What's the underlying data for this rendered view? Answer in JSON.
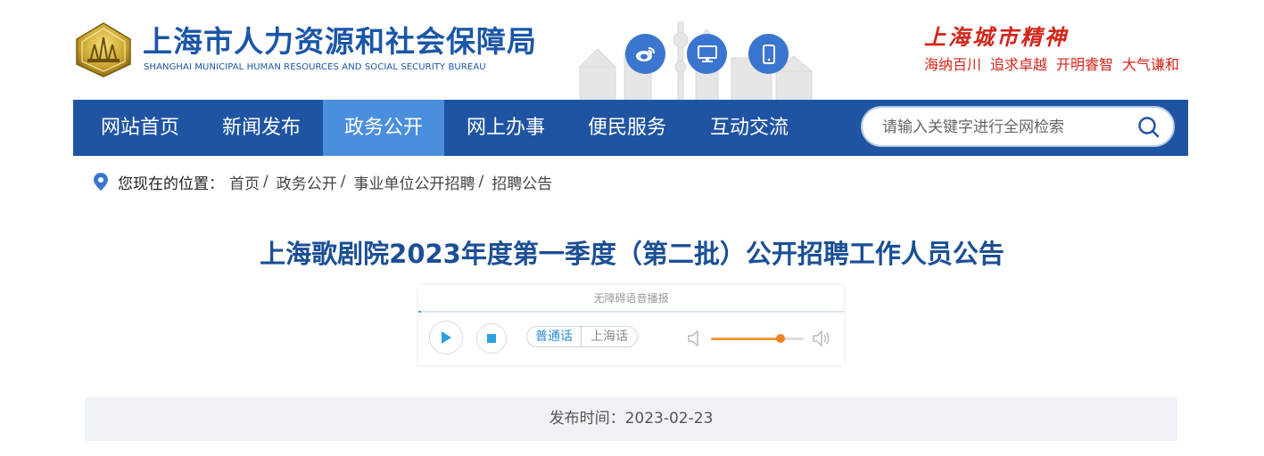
{
  "header": {
    "site_title": "上海市人力资源和社会保障局",
    "site_subtitle": "SHANGHAI MUNICIPAL HUMAN RESOURCES AND SOCIAL SECURITY BUREAU",
    "spirit_title": "上海城市精神",
    "spirit_words": [
      "海纳百川",
      "追求卓越",
      "开明睿智",
      "大气谦和"
    ],
    "icons": [
      "weibo-icon",
      "desktop-icon",
      "mobile-icon"
    ]
  },
  "nav": {
    "items": [
      {
        "label": "网站首页"
      },
      {
        "label": "新闻发布"
      },
      {
        "label": "政务公开"
      },
      {
        "label": "网上办事"
      },
      {
        "label": "便民服务"
      },
      {
        "label": "互动交流"
      }
    ],
    "active_label": "政务公开",
    "search_placeholder": "请输入关键字进行全网检索"
  },
  "breadcrumb": {
    "prefix": "您现在的位置",
    "colon": "：",
    "items": [
      "首页",
      "政务公开",
      "事业单位公开招聘",
      "招聘公告"
    ],
    "separator": "/"
  },
  "article": {
    "title": "上海歌剧院2023年度第一季度（第二批）公开招聘工作人员公告",
    "publish_time": "发布时间：2023-02-23"
  },
  "player": {
    "label": "无障碍语音播报",
    "lang_mandarin": "普通话",
    "lang_shanghai": "上海话",
    "volume": 0.75
  },
  "colors": {
    "brand_blue": "#1f54a3",
    "nav_active": "#4a8ede",
    "spirit_red": "#d32418",
    "title_blue": "#1b4f96"
  }
}
